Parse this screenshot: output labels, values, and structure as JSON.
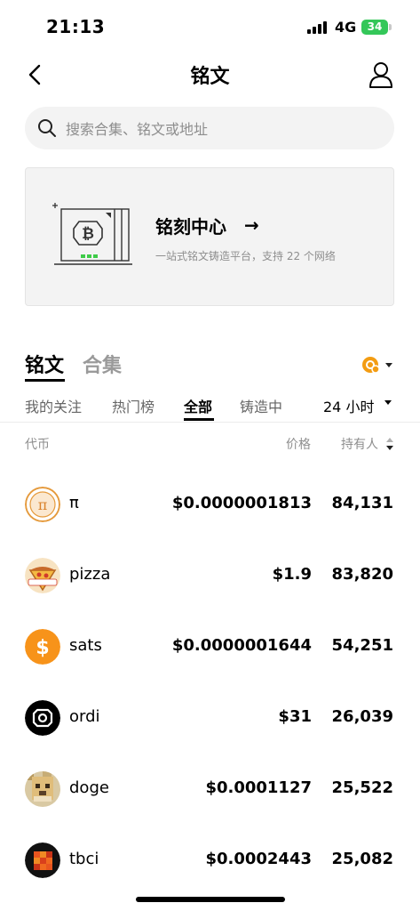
{
  "status_bar": {
    "time": "21:13",
    "network": "4G",
    "battery": "34"
  },
  "header": {
    "title": "铭文"
  },
  "search": {
    "placeholder": "搜索合集、铭文或地址"
  },
  "banner": {
    "title": "铭刻中心",
    "arrow": "→",
    "subtitle": "一站式铭文铸造平台，支持 22 个网络"
  },
  "main_tabs": [
    {
      "label": "铭文",
      "active": true
    },
    {
      "label": "合集",
      "active": false
    }
  ],
  "sub_tabs": [
    {
      "label": "我的关注",
      "active": false
    },
    {
      "label": "热门榜",
      "active": false
    },
    {
      "label": "全部",
      "active": true
    },
    {
      "label": "铸造中",
      "active": false
    }
  ],
  "period": {
    "selected": "24 小时"
  },
  "columns": {
    "token": "代币",
    "price": "价格",
    "holders": "持有人"
  },
  "rows": [
    {
      "name": "π",
      "price": "$0.0000001813",
      "holders": "84,131",
      "icon": "pi-icon"
    },
    {
      "name": "pizza",
      "price": "$1.9",
      "holders": "83,820",
      "icon": "pizza-icon"
    },
    {
      "name": "sats",
      "price": "$0.0000001644",
      "holders": "54,251",
      "icon": "sats-icon"
    },
    {
      "name": "ordi",
      "price": "$31",
      "holders": "26,039",
      "icon": "ordi-icon"
    },
    {
      "name": "doge",
      "price": "$0.0001127",
      "holders": "25,522",
      "icon": "doge-icon"
    },
    {
      "name": "tbci",
      "price": "$0.0002443",
      "holders": "25,082",
      "icon": "tbci-icon"
    }
  ],
  "colors": {
    "sats_orange": "#f7931a",
    "battery_green": "#34c759",
    "coin_orange": "#f39c12"
  }
}
